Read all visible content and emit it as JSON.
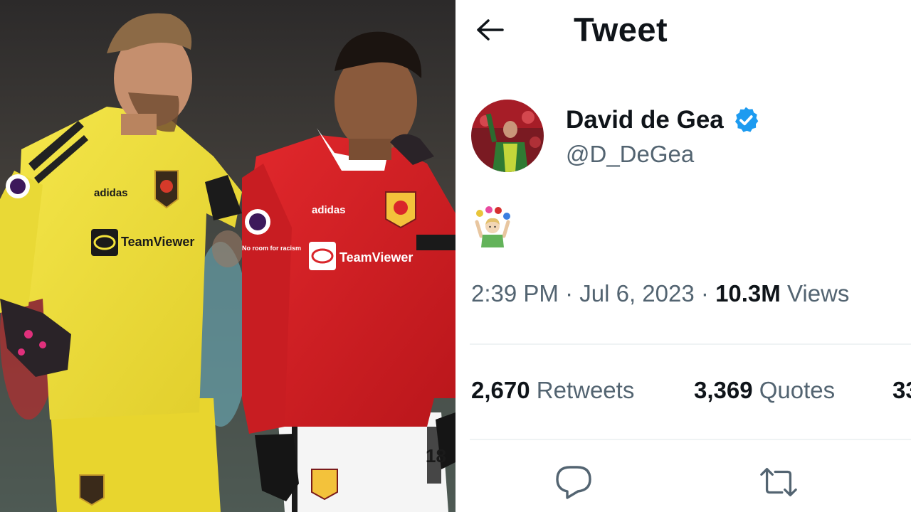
{
  "photo": {
    "sponsor_gk": "TeamViewer",
    "sponsor_outfield": "TeamViewer",
    "brand_gk": "adidas",
    "brand_outfield": "adidas",
    "sleeve_badge": "No room for racism",
    "shirt_number_partial": "18"
  },
  "header": {
    "back_icon": "arrow-left-icon",
    "title": "Tweet"
  },
  "author": {
    "display_name": "David de Gea",
    "handle": "@D_DeGea",
    "verified": true,
    "verified_color": "#1d9bf0"
  },
  "tweet": {
    "emoji": "juggler"
  },
  "meta": {
    "time": "2:39 PM",
    "separator": "·",
    "date": "Jul 6, 2023",
    "views_count": "10.3M",
    "views_label": "Views"
  },
  "stats": {
    "retweets_count": "2,670",
    "retweets_label": "Retweets",
    "quotes_count": "3,369",
    "quotes_label": "Quotes",
    "likes_count_partial": "33"
  },
  "actions": {
    "reply_icon": "reply-icon",
    "retweet_icon": "retweet-icon"
  },
  "colors": {
    "text_primary": "#0f1419",
    "text_secondary": "#536471",
    "divider": "#eff3f4",
    "accent": "#1d9bf0",
    "gk_kit": "#f2e23a",
    "home_kit": "#d91f26"
  }
}
